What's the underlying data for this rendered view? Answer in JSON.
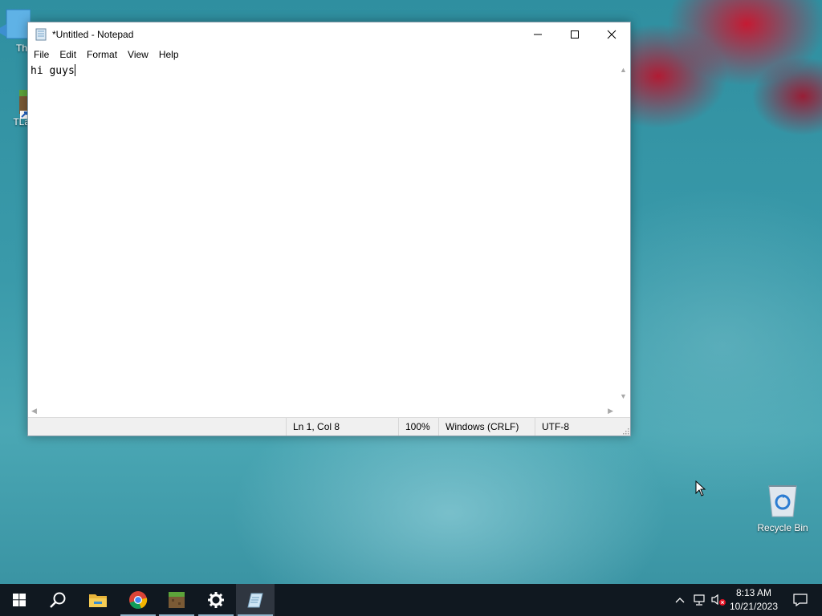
{
  "desktop": {
    "icons": [
      {
        "label": "Th",
        "icon": "windows-icon"
      },
      {
        "label": "TLau",
        "icon": "minecraft-block-icon"
      },
      {
        "label": "Recycle Bin",
        "icon": "recycle-bin-icon"
      }
    ]
  },
  "notepad": {
    "title": "*Untitled - Notepad",
    "menu": [
      "File",
      "Edit",
      "Format",
      "View",
      "Help"
    ],
    "content": "hi guys",
    "status": {
      "position": "Ln 1, Col 8",
      "zoom": "100%",
      "line_ending": "Windows (CRLF)",
      "encoding": "UTF-8"
    }
  },
  "taskbar": {
    "apps": [
      "start-icon",
      "search-icon",
      "file-explorer-icon",
      "chrome-icon",
      "minecraft-icon",
      "settings-icon",
      "notepad-icon"
    ],
    "clock": {
      "time": "8:13 AM",
      "date": "10/21/2023"
    }
  },
  "colors": {
    "taskbar": "#101820",
    "accent": "#8fb2c8",
    "statusbar": "#f0f0f0"
  }
}
